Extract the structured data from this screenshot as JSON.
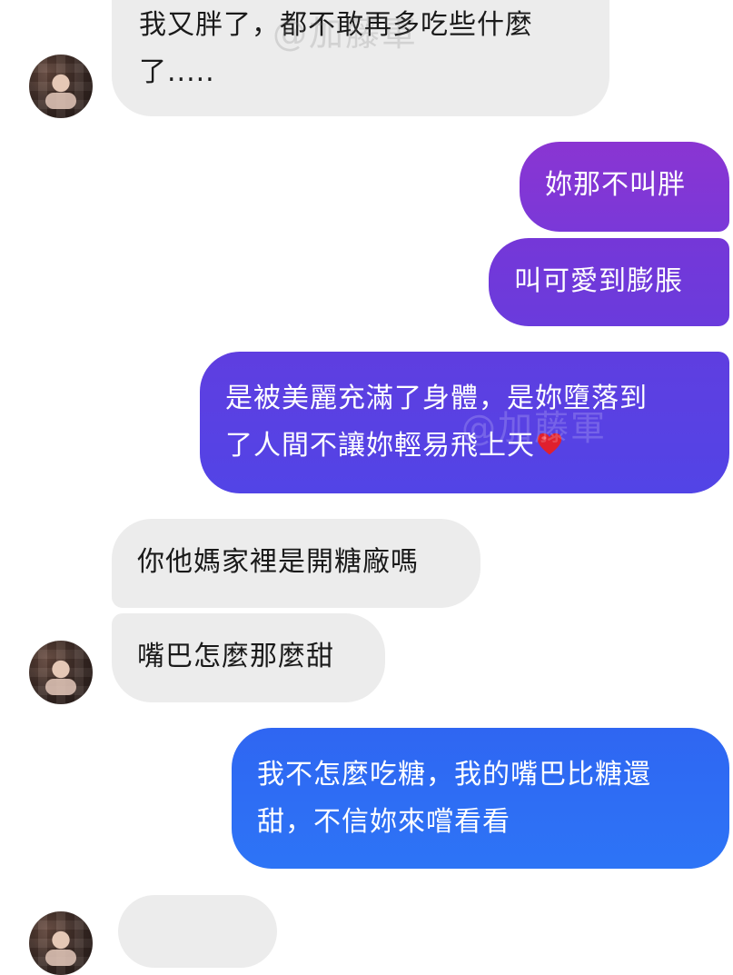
{
  "watermark": "@加藤軍",
  "messages": [
    {
      "lines": [
        "我又胖了，都不敢再多吃些什麼",
        "了....."
      ]
    },
    {
      "lines": [
        "妳那不叫胖"
      ]
    },
    {
      "lines": [
        "叫可愛到膨脹"
      ]
    },
    {
      "lines": [
        "是被美麗充滿了身體，是妳墮落到",
        "了人間不讓妳輕易飛上天"
      ],
      "emoji": "heart-emoji"
    },
    {
      "lines": [
        "你他媽家裡是開糖廠嗎"
      ]
    },
    {
      "lines": [
        "嘴巴怎麼那麼甜"
      ]
    },
    {
      "lines": [
        "我不怎麼吃糖，我的嘴巴比糖還",
        "甜，不信妳來嚐看看"
      ]
    }
  ],
  "colors": {
    "incoming_bubble": "#ececec",
    "outgoing_purple": "#7a37d6",
    "outgoing_indigo": "#5a3fe0",
    "outgoing_blue": "#2f6ef5",
    "heart": "#e0202e"
  }
}
